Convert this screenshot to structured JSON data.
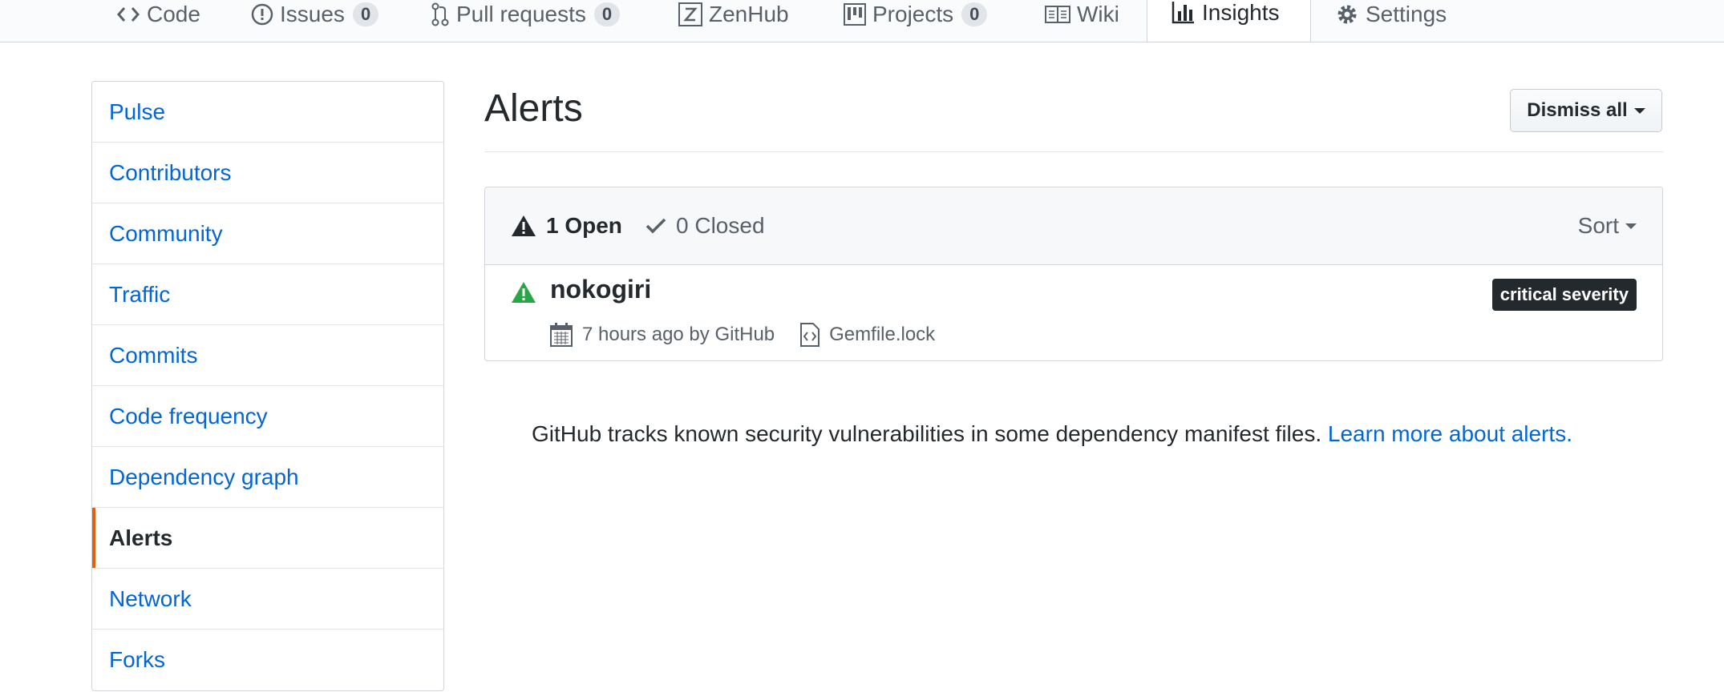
{
  "tabs": [
    {
      "label": "Code",
      "icon": "code-icon"
    },
    {
      "label": "Issues",
      "icon": "issue-icon",
      "count": "0"
    },
    {
      "label": "Pull requests",
      "icon": "pull-request-icon",
      "count": "0"
    },
    {
      "label": "ZenHub",
      "icon": "zenhub-icon"
    },
    {
      "label": "Projects",
      "icon": "project-icon",
      "count": "0"
    },
    {
      "label": "Wiki",
      "icon": "book-icon"
    },
    {
      "label": "Insights",
      "icon": "graph-icon",
      "selected": true
    },
    {
      "label": "Settings",
      "icon": "gear-icon"
    }
  ],
  "sidebar": {
    "items": [
      {
        "label": "Pulse"
      },
      {
        "label": "Contributors"
      },
      {
        "label": "Community"
      },
      {
        "label": "Traffic"
      },
      {
        "label": "Commits"
      },
      {
        "label": "Code frequency"
      },
      {
        "label": "Dependency graph"
      },
      {
        "label": "Alerts",
        "selected": true
      },
      {
        "label": "Network"
      },
      {
        "label": "Forks"
      }
    ]
  },
  "main": {
    "title": "Alerts",
    "dismiss_label": "Dismiss all",
    "open_label": "1 Open",
    "closed_label": "0 Closed",
    "sort_label": "Sort",
    "alert": {
      "name": "nokogiri",
      "time": "7 hours ago by GitHub",
      "file": "Gemfile.lock",
      "severity": "critical severity"
    },
    "notice_text": "GitHub tracks known security vulnerabilities in some dependency manifest files.",
    "notice_link": "Learn more about alerts."
  },
  "colors": {
    "link": "#0366d6",
    "selected_accent": "#e36209",
    "alert_icon": "#28a745",
    "badge_bg": "#24292e"
  }
}
